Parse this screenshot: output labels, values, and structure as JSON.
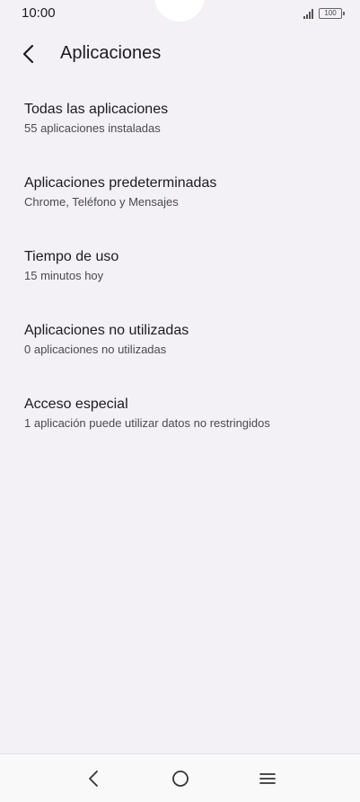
{
  "status_bar": {
    "time": "10:00",
    "battery": "100"
  },
  "header": {
    "title": "Aplicaciones",
    "back_icon": "chevron-left-icon"
  },
  "items": [
    {
      "title": "Todas las aplicaciones",
      "subtitle": "55 aplicaciones instaladas"
    },
    {
      "title": "Aplicaciones predeterminadas",
      "subtitle": "Chrome, Teléfono y Mensajes"
    },
    {
      "title": "Tiempo de uso",
      "subtitle": "15 minutos hoy"
    },
    {
      "title": "Aplicaciones no utilizadas",
      "subtitle": "0 aplicaciones no utilizadas"
    },
    {
      "title": "Acceso especial",
      "subtitle": "1 aplicación puede utilizar datos no restringidos"
    }
  ],
  "nav_bar": {
    "back_icon": "triangle-back-icon",
    "home_icon": "circle-home-icon",
    "menu_icon": "hamburger-menu-icon"
  },
  "colors": {
    "background": "#f3f1f5",
    "text_primary": "#1c1b1f",
    "text_secondary": "#4a4a4f"
  }
}
